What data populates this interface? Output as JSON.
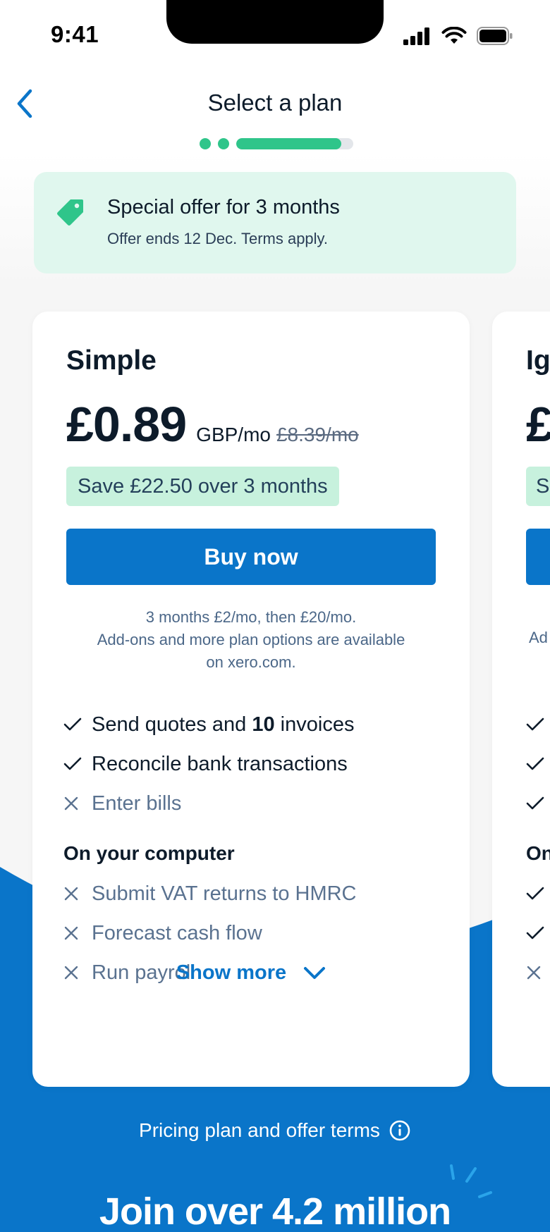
{
  "status_bar": {
    "time": "9:41"
  },
  "header": {
    "title": "Select a plan",
    "progress": {
      "steps_done": 2,
      "current_fill": 0.9
    }
  },
  "offer": {
    "title": "Special offer for 3 months",
    "subtitle": "Offer ends 12 Dec. Terms apply."
  },
  "plan": {
    "name": "Simple",
    "price": "£0.89",
    "unit": "GBP/mo",
    "old_price": "£8.39/mo",
    "save": "Save £22.50 over 3 months",
    "buy_label": "Buy now",
    "fine_print": [
      "3 months £2/mo, then £20/mo.",
      "Add-ons and more plan options are available",
      "on xero.com."
    ],
    "features": [
      {
        "pre": "Send quotes and ",
        "bold": "10",
        "post": " invoices",
        "included": true
      },
      {
        "pre": "Reconcile bank transactions",
        "included": true
      },
      {
        "pre": "Enter bills",
        "included": false
      }
    ],
    "section_title": "On your computer",
    "computer_features": [
      {
        "pre": "Submit VAT returns to HMRC",
        "included": false
      },
      {
        "pre": "Forecast cash flow",
        "included": false
      },
      {
        "pre": "Run payroll",
        "included": false
      }
    ],
    "show_more": "Show more"
  },
  "next_plan": {
    "name": "Ig",
    "price": "£",
    "save": "S",
    "fine": "Ad",
    "section": "On"
  },
  "footer": {
    "terms_link": "Pricing plan and offer terms",
    "join_title": "Join over 4.2 million"
  },
  "colors": {
    "brand_blue": "#0a75c9",
    "success_green": "#2fc58a",
    "offer_bg": "#e0f7ee",
    "badge_bg": "#c7f1dd"
  },
  "icons": [
    "back-chevron-icon",
    "signal-icon",
    "wifi-icon",
    "battery-icon",
    "price-tag-icon",
    "check-icon",
    "cross-icon",
    "chevron-down-icon",
    "info-icon",
    "sparkle-icon"
  ]
}
